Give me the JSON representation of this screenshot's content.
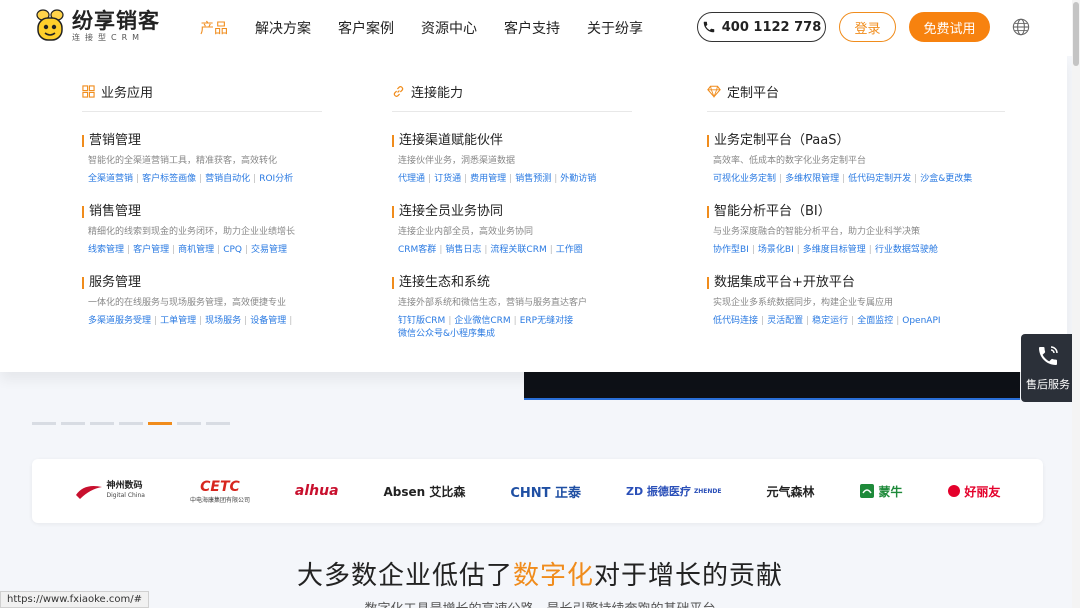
{
  "logo": {
    "title": "纷享销客",
    "subtitle": "连接型CRM"
  },
  "nav": [
    "产品",
    "解决方案",
    "客户案例",
    "资源中心",
    "客户支持",
    "关于纷享"
  ],
  "header_actions": {
    "phone": "400 1122 778",
    "login": "登录",
    "trial": "免费试用"
  },
  "columns": [
    {
      "heading": "业务应用",
      "icon": "grid-icon",
      "groups": [
        {
          "title": "营销管理",
          "desc": "智能化的全渠道营销工具，精准获客，高效转化",
          "links": [
            "全渠道营销",
            "客户标签画像",
            "营销自动化",
            "ROI分析"
          ]
        },
        {
          "title": "销售管理",
          "desc": "精细化的线索到现金的业务闭环，助力企业业绩增长",
          "links": [
            "线索管理",
            "客户管理",
            "商机管理",
            "CPQ",
            "交易管理"
          ]
        },
        {
          "title": "服务管理",
          "desc": "一体化的在线服务与现场服务管理，高效便捷专业",
          "links": [
            "多渠道服务受理",
            "工单管理",
            "现场服务",
            "设备管理",
            ""
          ]
        }
      ]
    },
    {
      "heading": "连接能力",
      "icon": "link-icon",
      "groups": [
        {
          "title": "连接渠道赋能伙伴",
          "desc": "连接伙伴业务，洞悉渠道数据",
          "links": [
            "代理通",
            "订货通",
            "费用管理",
            "销售预测",
            "外勤访销"
          ]
        },
        {
          "title": "连接全员业务协同",
          "desc": "连接企业内部全员，高效业务协同",
          "links": [
            "CRM客群",
            "销售日志",
            "流程关联CRM",
            "工作圈"
          ]
        },
        {
          "title": "连接生态和系统",
          "desc": "连接外部系统和微信生态，营销与服务直达客户",
          "links": [
            "钉钉版CRM",
            "企业微信CRM",
            "ERP无缝对接"
          ],
          "links2": [
            "微信公众号&小程序集成"
          ]
        }
      ]
    },
    {
      "heading": "定制平台",
      "icon": "diamond-icon",
      "groups": [
        {
          "title": "业务定制平台（PaaS）",
          "desc": "高效率、低成本的数字化业务定制平台",
          "links": [
            "可视化业务定制",
            "多维权限管理",
            "低代码定制开发",
            "沙盒&更改集"
          ]
        },
        {
          "title": "智能分析平台（BI）",
          "desc": "与业务深度融合的智能分析平台，助力企业科学决策",
          "links": [
            "协作型BI",
            "场景化BI",
            "多维度目标管理",
            "行业数据驾驶舱"
          ]
        },
        {
          "title": "数据集成平台+开放平台",
          "desc": "实现企业多系统数据同步，构建企业专属应用",
          "links": [
            "低代码连接",
            "灵活配置",
            "稳定运行",
            "全面监控",
            "OpenAPI"
          ]
        }
      ]
    }
  ],
  "brands": [
    {
      "name": "神州数码",
      "sub": "Digital China",
      "color": "#c8102e"
    },
    {
      "name": "CETC",
      "sub": "中电海康集团有限公司",
      "color": "#d7261e"
    },
    {
      "name": "alhua",
      "sub": "",
      "color": "#c8102e"
    },
    {
      "name": "Absen 艾比森",
      "sub": "",
      "color": "#222222"
    },
    {
      "name": "CHNT 正泰",
      "sub": "",
      "color": "#1f4fa3"
    },
    {
      "name": "ZD 振德医疗",
      "sub": "ZHENDE",
      "color": "#2a4fb8"
    },
    {
      "name": "元气森林",
      "sub": "",
      "color": "#222222"
    },
    {
      "name": "蒙牛",
      "sub": "",
      "color": "#1e8a3a"
    },
    {
      "name": "好丽友",
      "sub": "",
      "color": "#e4002b"
    }
  ],
  "headline": {
    "pre": "大多数企业低估了",
    "highlight": "数字化",
    "post": "对于增长的贡献"
  },
  "subline": "数字化工具是增长的高速公路，是长引擎持续奔跑的基础平台",
  "service": {
    "label": "售后服务"
  },
  "status_url": "https://www.fxiaoke.com/#",
  "colors": {
    "accent": "#f08c1c",
    "link": "#2a7ae2",
    "service_bg": "#2b3039"
  }
}
